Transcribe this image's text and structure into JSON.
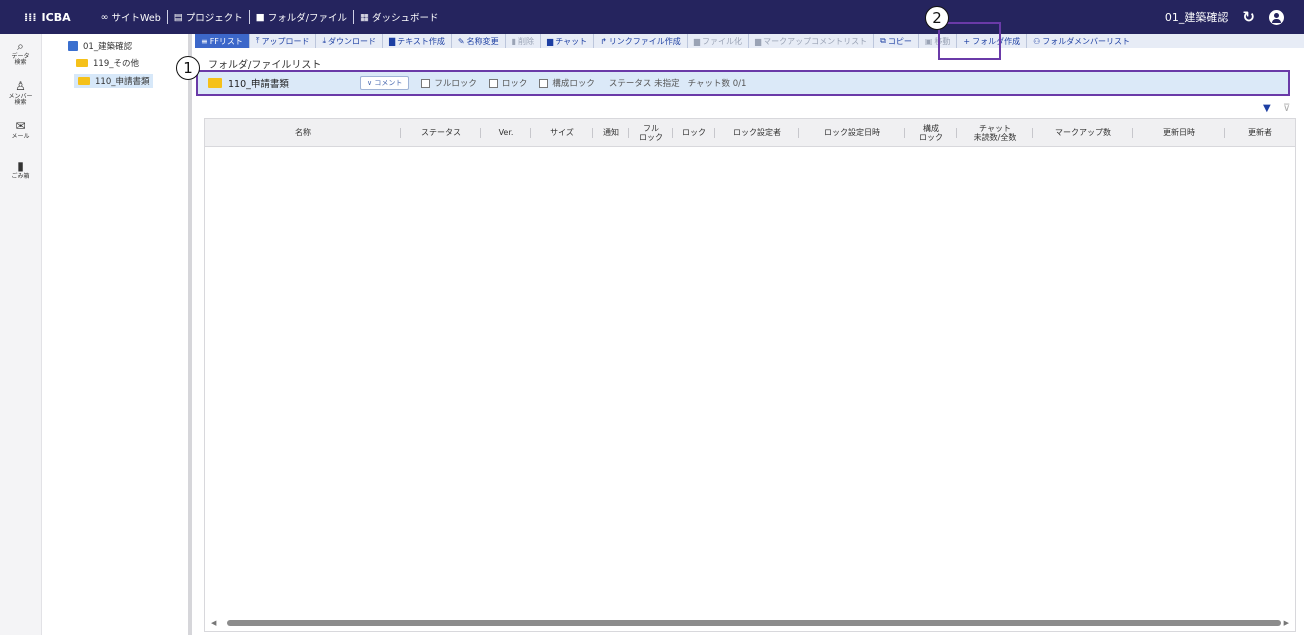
{
  "topbar": {
    "brand": "ICBA",
    "nav": [
      {
        "icon": "link-icon",
        "glyph": "∞",
        "label": "サイトWeb"
      },
      {
        "icon": "project-icon",
        "glyph": "▤",
        "label": "プロジェクト"
      },
      {
        "icon": "folder-icon",
        "glyph": "■",
        "label": "フォルダ/ファイル"
      },
      {
        "icon": "dashboard-icon",
        "glyph": "▦",
        "label": "ダッシュボード"
      }
    ],
    "project_name": "01_建築確認"
  },
  "rail": [
    {
      "icon": "data-search-icon",
      "glyph": "⌕",
      "label1": "データ",
      "label2": "検索"
    },
    {
      "icon": "member-search-icon",
      "glyph": "♙",
      "label1": "メンバー",
      "label2": "検索"
    },
    {
      "icon": "mail-icon",
      "glyph": "✉",
      "label1": "メール",
      "label2": ""
    },
    {
      "icon": "trash-icon",
      "glyph": "▮",
      "label1": "ごみ箱",
      "label2": ""
    }
  ],
  "tree": {
    "root": "01_建築確認",
    "children": [
      "119_その他",
      "110_申請書類"
    ]
  },
  "toolbar": [
    {
      "label": "FFリスト",
      "glyph": "≡",
      "state": "active"
    },
    {
      "label": "アップロード",
      "glyph": "⤒",
      "state": "normal"
    },
    {
      "label": "ダウンロード",
      "glyph": "⤓",
      "state": "normal"
    },
    {
      "label": "テキスト作成",
      "glyph": "▇",
      "state": "normal"
    },
    {
      "label": "名称変更",
      "glyph": "✎",
      "state": "normal"
    },
    {
      "label": "削除",
      "glyph": "▮",
      "state": "disabled"
    },
    {
      "label": "チャット",
      "glyph": "▆",
      "state": "normal"
    },
    {
      "label": "リンクファイル作成",
      "glyph": "↱",
      "state": "normal"
    },
    {
      "label": "ファイル化",
      "glyph": "▆",
      "state": "disabled"
    },
    {
      "label": "マークアップコメントリスト",
      "glyph": "▆",
      "state": "disabled"
    },
    {
      "label": "コピー",
      "glyph": "⧉",
      "state": "normal"
    },
    {
      "label": "移動",
      "glyph": "▣",
      "state": "disabled"
    },
    {
      "label": "フォルダ作成",
      "glyph": "+",
      "state": "normal"
    },
    {
      "label": "フォルダメンバーリスト",
      "glyph": "⚇",
      "state": "normal"
    }
  ],
  "section_title": "フォルダ/ファイルリスト",
  "selected_item": {
    "name": "110_申請書類",
    "comment_button": "∨ コメント",
    "checkboxes": [
      "フルロック",
      "ロック",
      "構成ロック"
    ],
    "status": "ステータス 未指定",
    "chat_count": "チャット数 0/1"
  },
  "table": {
    "columns": [
      {
        "line1": "名称",
        "line2": ""
      },
      {
        "line1": "ステータス",
        "line2": ""
      },
      {
        "line1": "Ver.",
        "line2": ""
      },
      {
        "line1": "サイズ",
        "line2": ""
      },
      {
        "line1": "通知",
        "line2": ""
      },
      {
        "line1": "フル",
        "line2": "ロック"
      },
      {
        "line1": "ロック",
        "line2": ""
      },
      {
        "line1": "ロック設定者",
        "line2": ""
      },
      {
        "line1": "ロック設定日時",
        "line2": ""
      },
      {
        "line1": "構成",
        "line2": "ロック"
      },
      {
        "line1": "チャット",
        "line2": "未読数/全数"
      },
      {
        "line1": "マークアップ数",
        "line2": ""
      },
      {
        "line1": "更新日時",
        "line2": ""
      },
      {
        "line1": "更新者",
        "line2": ""
      }
    ],
    "rows": []
  },
  "annotations": [
    "1",
    "2"
  ]
}
